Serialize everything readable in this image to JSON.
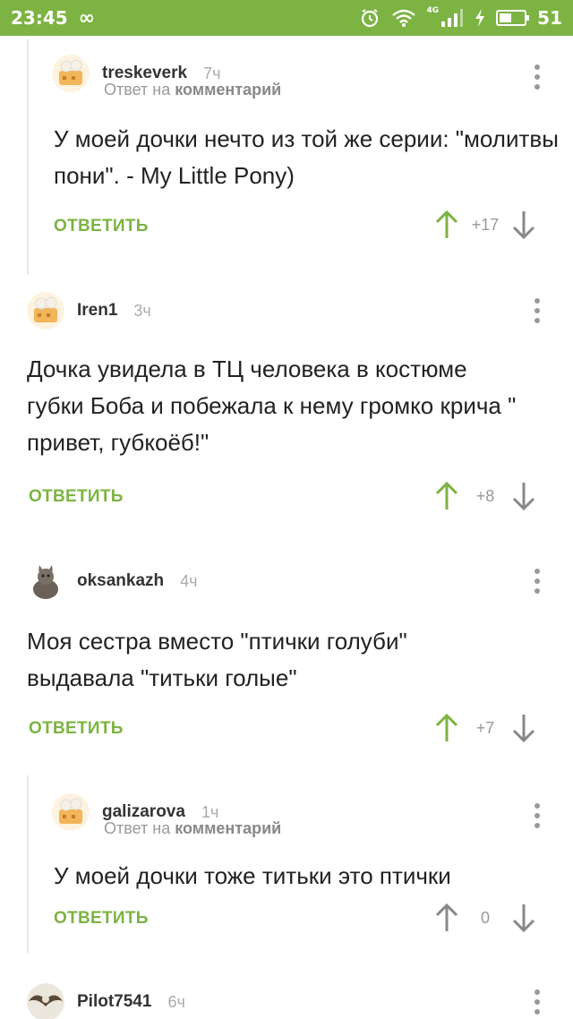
{
  "status_bar": {
    "time": "23:45",
    "loop_icon": "infinity-icon",
    "network_tag": "4G",
    "battery_level": "51",
    "battery_fraction": 0.51,
    "accent_color": "#7cb342"
  },
  "comments": [
    {
      "username": "treskeverk",
      "time": "7ч",
      "reply_prefix": "Ответ на ",
      "reply_target": "комментарий",
      "text": "У моей дочки нечто из той же серии: \"молитвы пони\". - My Little Pony)",
      "reply_label": "ОТВЕТИТЬ",
      "score": "+17",
      "avatar": "bear-cake-avatar"
    },
    {
      "username": "Iren1",
      "time": "3ч",
      "text": "Дочка увидела в ТЦ человека в костюме губки Боба и побежала к нему громко крича \" привет, губкоёб!\"",
      "reply_label": "ОТВЕТИТЬ",
      "score": "+8",
      "avatar": "bear-cake-avatar"
    },
    {
      "username": "oksankazh",
      "time": "4ч",
      "text": "Моя сестра вместо \"птички голуби\" выдавала \"титьки голые\"",
      "reply_label": "ОТВЕТИТЬ",
      "score": "+7",
      "avatar": "cat-avatar"
    },
    {
      "username": "galizarova",
      "time": "1ч",
      "reply_prefix": "Ответ на ",
      "reply_target": "комментарий",
      "text": "У моей дочки тоже титьки это птички",
      "reply_label": "ОТВЕТИТЬ",
      "score": "0",
      "avatar": "bear-cake-avatar"
    },
    {
      "username": "Pilot7541",
      "time": "6ч",
      "avatar": "eagle-avatar"
    }
  ]
}
